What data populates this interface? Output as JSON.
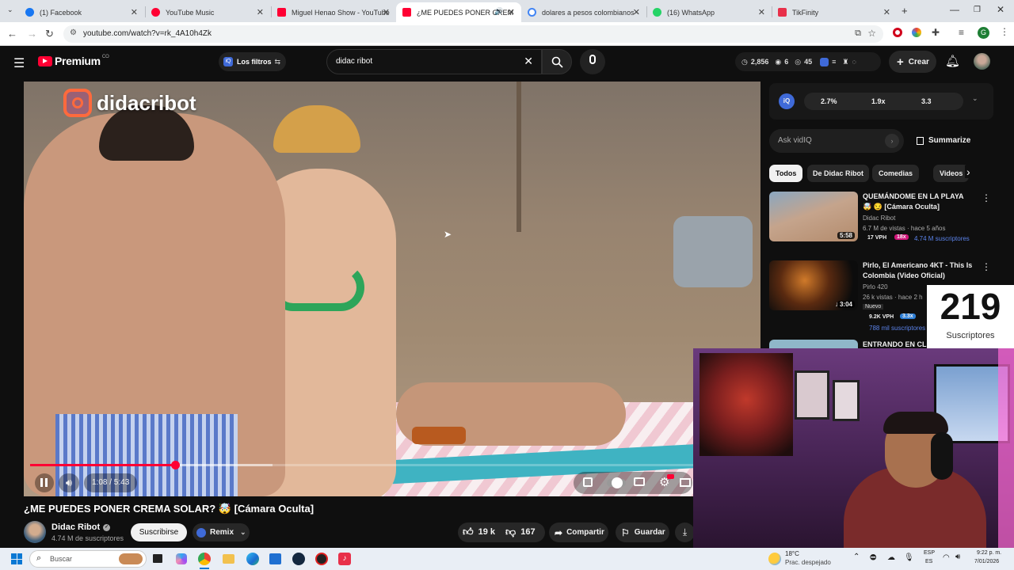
{
  "tabs": [
    {
      "title": "(1) Facebook",
      "color": "#1877f2"
    },
    {
      "title": "YouTube Music",
      "color": "#ff0033"
    },
    {
      "title": "Miguel Henao Show - YouTube",
      "color": "#ff0033"
    },
    {
      "title": "¿ME PUEDES PONER CREM",
      "color": "#ff0033"
    },
    {
      "title": "dolares a pesos colombianos -",
      "color": "#4285f4"
    },
    {
      "title": "(16) WhatsApp",
      "color": "#25d366"
    },
    {
      "title": "TikFinity",
      "color": "#e8304a"
    }
  ],
  "address": {
    "url": "youtube.com/watch?v=rk_4A10h4Zk"
  },
  "yt": {
    "logo": "Premium",
    "logo_sup": "CO",
    "filters_label": "Los filtros",
    "search_value": "didac ribot",
    "stats": {
      "views": "2,856",
      "a": "6",
      "b": "45"
    },
    "create_label": "Crear"
  },
  "video": {
    "watermark": "didacribot",
    "time": "1:08 / 5:43",
    "progress": 0.2,
    "buffer": 0.335,
    "title": "¿ME PUEDES PONER CREMA SOLAR? 🤯 [Cámara Oculta]",
    "channel": "Didac Ribot",
    "subs": "4.74 M de suscriptores",
    "subscribe_label": "Suscribirse",
    "remix_label": "Remix",
    "likes": "19 k",
    "dislikes": "167",
    "share_label": "Compartir",
    "save_label": "Guardar"
  },
  "vidiq": {
    "metrics": [
      "2.7%",
      "1.9x",
      "3.3"
    ],
    "ask_placeholder": "Ask vidIQ",
    "summarize_label": "Summarize"
  },
  "chips": [
    "Todos",
    "De Didac Ribot",
    "Comedias",
    "Videos"
  ],
  "recs": [
    {
      "title": "QUEMÁNDOME EN LA PLAYA",
      "title2": "🤯 😏 [Cámara Oculta]",
      "channel": "Didac Ribot",
      "meta": "6.7 M de vistas · hace 5 años",
      "duration": "5:58",
      "vph": "17 VPH",
      "mult": "18x",
      "subs": "4.74 M suscriptores"
    },
    {
      "title": "Pirlo, El Americano 4KT - This Is",
      "title2": "Colombia (Video Oficial)",
      "channel": "Pirlo 420",
      "meta": "26 k vistas · hace 2 h",
      "duration": "3:04",
      "badge": "Nuevo",
      "vph": "9.2K VPH",
      "mult": "3.3x",
      "subs": "788 mil suscriptores"
    },
    {
      "title": "ENTRANDO EN CL",
      "title2": "",
      "channel": "",
      "meta": "",
      "duration": ""
    }
  ],
  "overlay": {
    "count": "219",
    "label": "Suscriptores"
  },
  "taskbar": {
    "search_placeholder": "Buscar",
    "weather_temp": "18°C",
    "weather_desc": "Prac. despejado",
    "lang1": "ESP",
    "lang2": "ES",
    "time": "9:22 p. m.",
    "date": "7/01/2026"
  }
}
